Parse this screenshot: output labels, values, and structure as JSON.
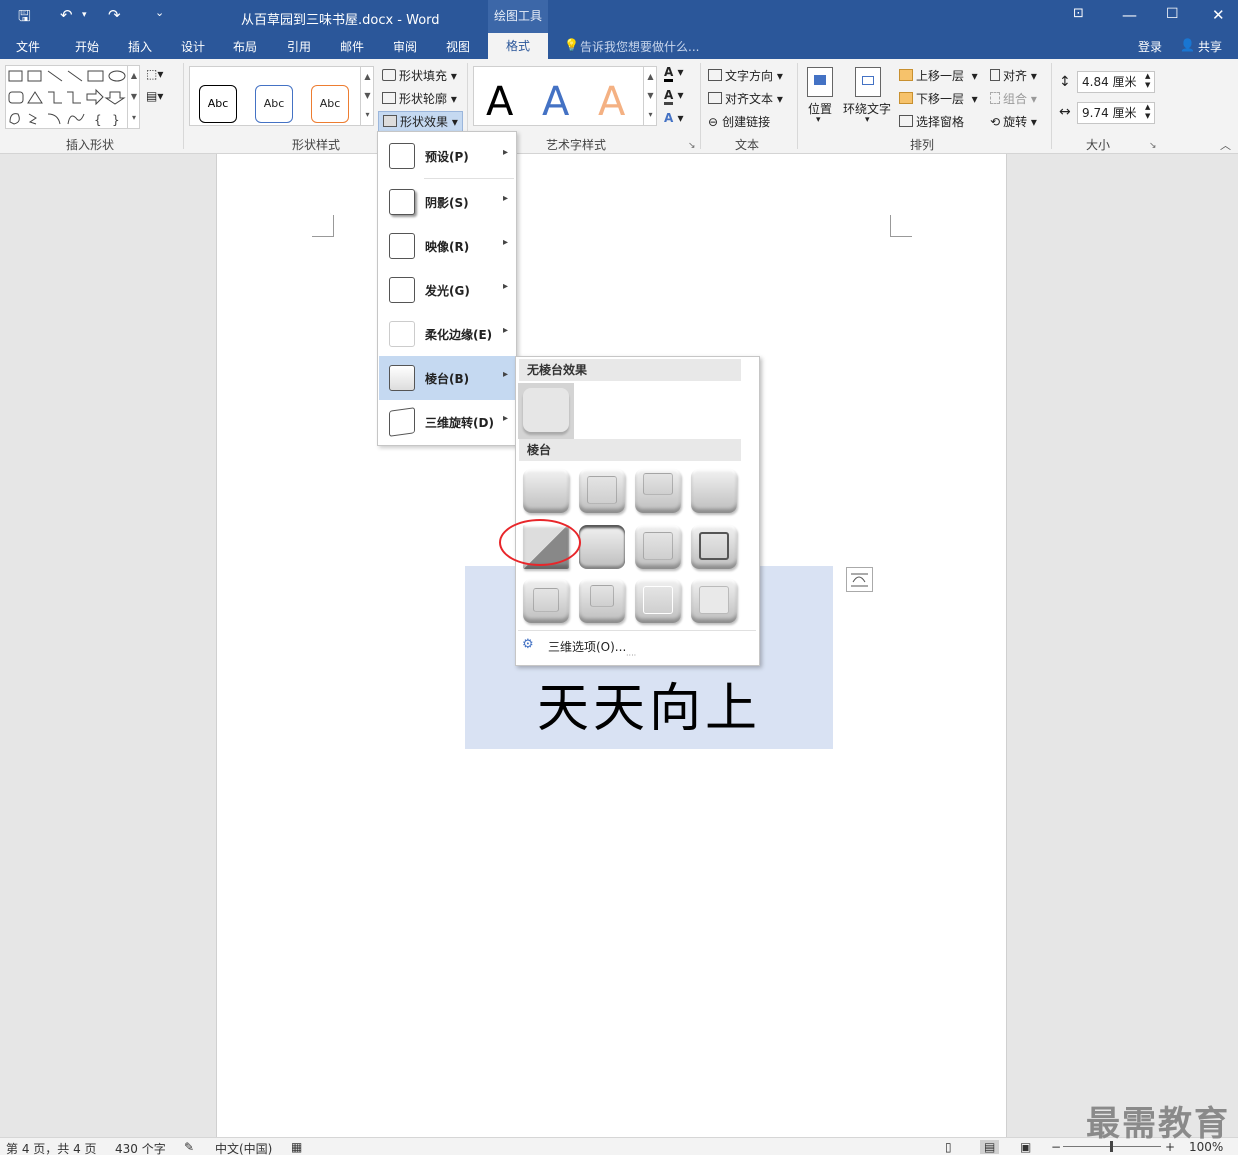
{
  "window": {
    "title": "从百草园到三味书屋.docx - Word",
    "context_tab_group": "绘图工具"
  },
  "qat": {
    "save": "🖫",
    "undo": "↶",
    "redo": "↷",
    "more": "⌄"
  },
  "tabs": [
    "文件",
    "开始",
    "插入",
    "设计",
    "布局",
    "引用",
    "邮件",
    "审阅",
    "视图"
  ],
  "active_tab": "格式",
  "tell_me": "告诉我您想要做什么...",
  "account": {
    "signin": "登录",
    "share": "共享"
  },
  "ribbon": {
    "insert_shapes_label": "插入形状",
    "shape_styles": {
      "label": "形状样式",
      "sample": "Abc",
      "fill": "形状填充",
      "outline": "形状轮廓",
      "effects": "形状效果"
    },
    "wordart": {
      "label": "艺术字样式",
      "letter": "A"
    },
    "text": {
      "label": "文本",
      "direction": "文字方向",
      "align": "对齐文本",
      "link": "创建链接"
    },
    "arrange": {
      "label": "排列",
      "position": "位置",
      "wrap": "环绕文字",
      "forward": "上移一层",
      "backward": "下移一层",
      "pane": "选择窗格",
      "align": "对齐",
      "group": "组合",
      "rotate": "旋转"
    },
    "size": {
      "label": "大小",
      "height": "4.84 厘米",
      "width": "9.74 厘米"
    }
  },
  "effects_menu": [
    {
      "label": "预设(P)"
    },
    {
      "label": "阴影(S)"
    },
    {
      "label": "映像(R)"
    },
    {
      "label": "发光(G)"
    },
    {
      "label": "柔化边缘(E)"
    },
    {
      "label": "棱台(B)"
    },
    {
      "label": "三维旋转(D)"
    }
  ],
  "bevel_menu": {
    "no_bevel": "无棱台效果",
    "bevel": "棱台",
    "options": "三维选项(O)..."
  },
  "document": {
    "shape_text": "天天向上"
  },
  "status": {
    "page": "第 4 页，共 4 页",
    "words": "430 个字",
    "language": "中文(中国)",
    "zoom": "100%"
  },
  "watermark": "最需教育"
}
